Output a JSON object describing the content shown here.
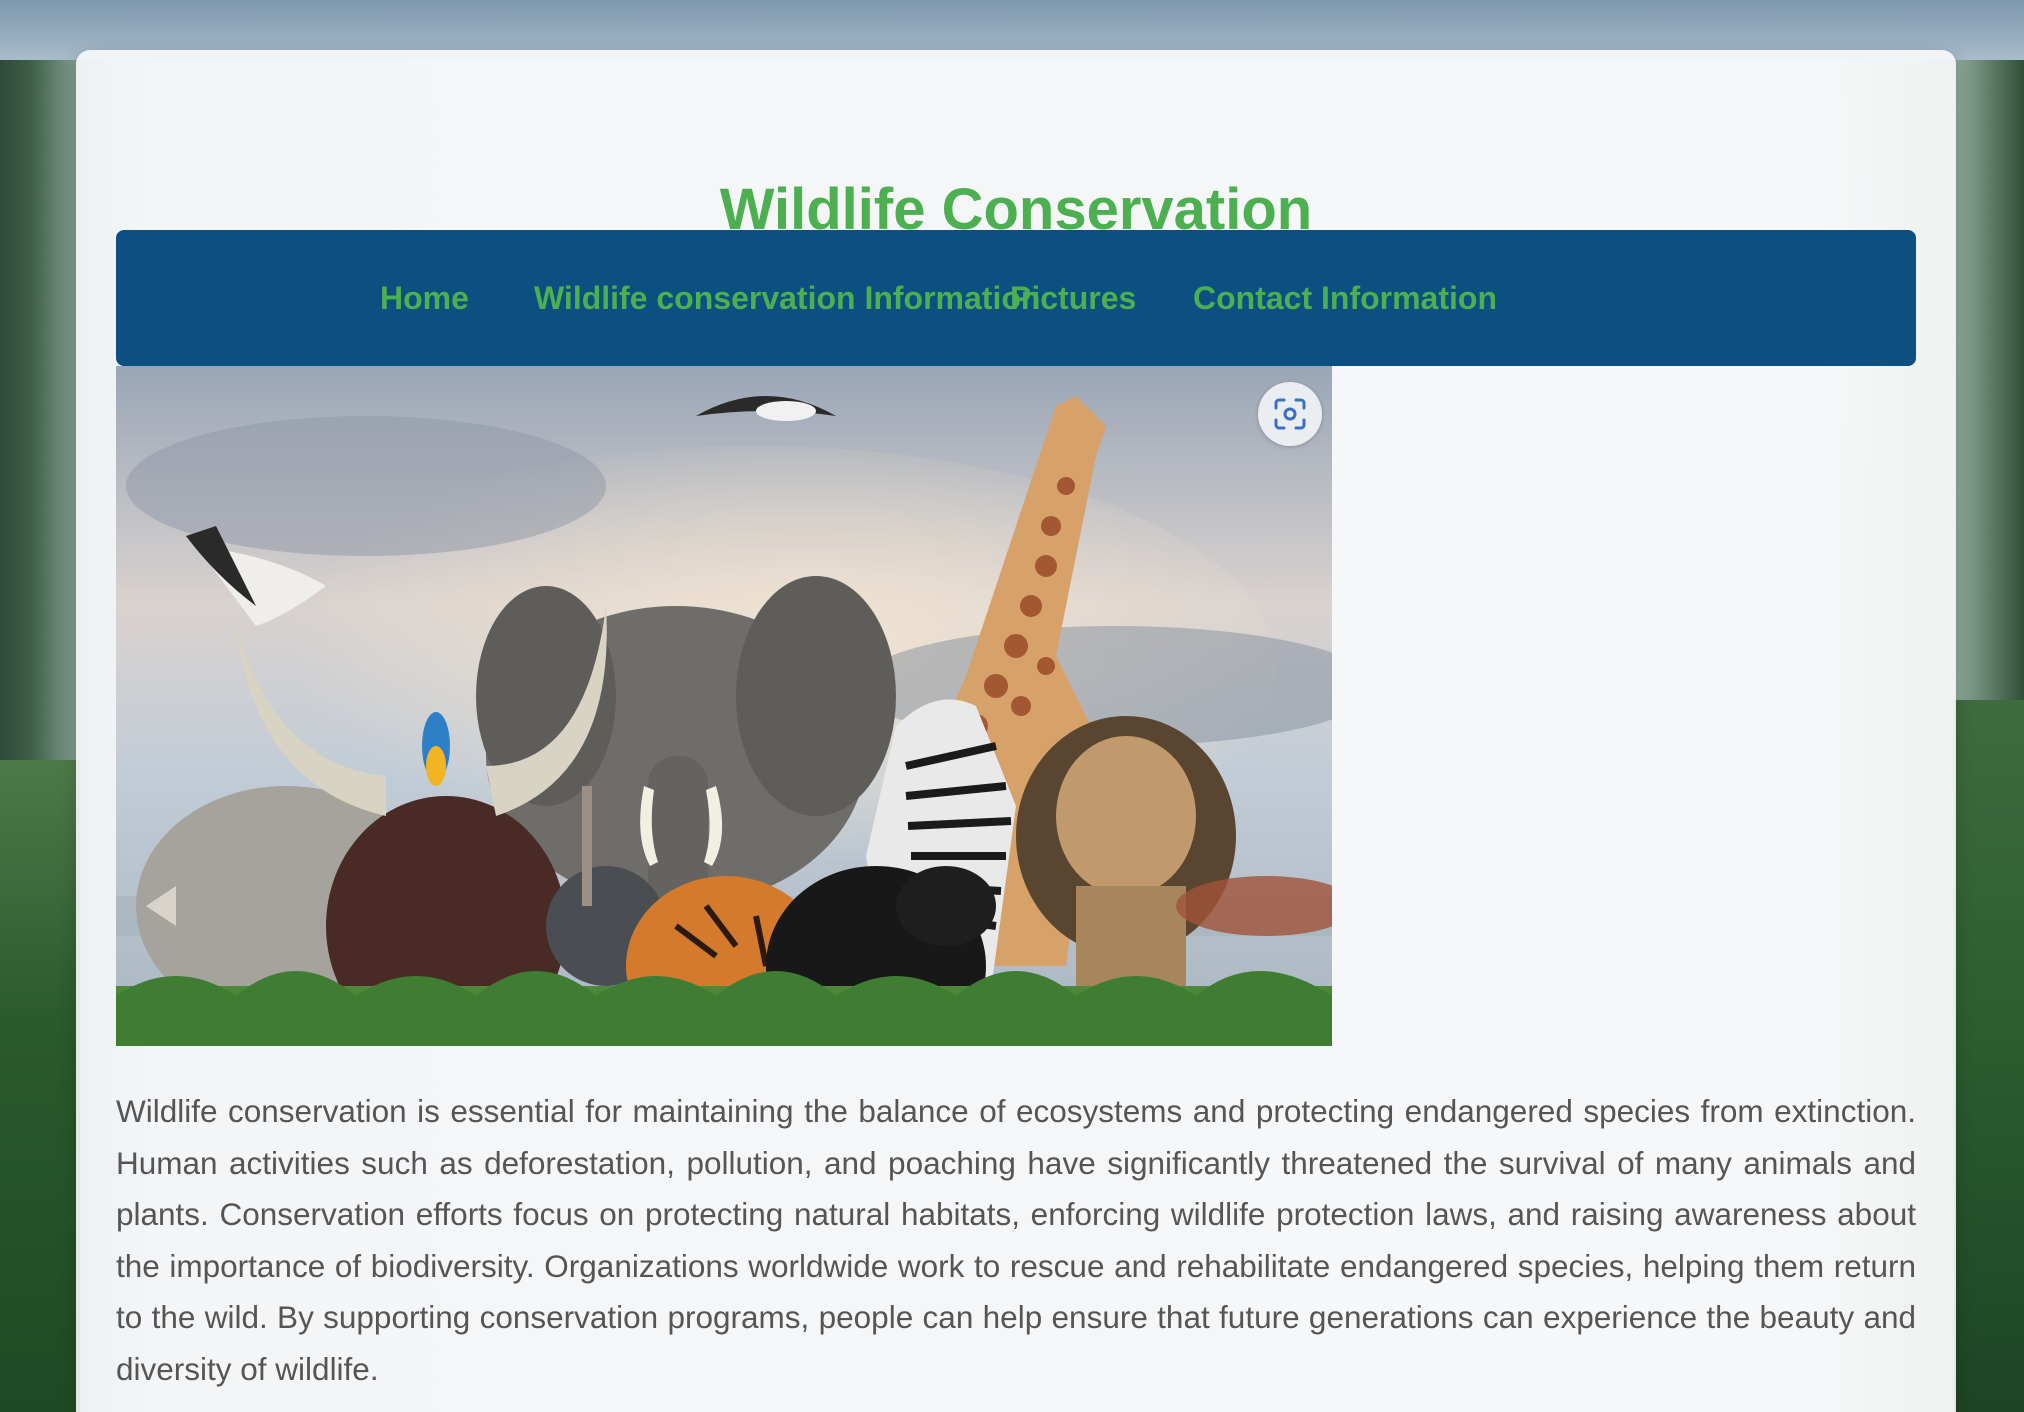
{
  "page": {
    "title": "Wildlife Conservation"
  },
  "nav": {
    "items": [
      {
        "label": "Home"
      },
      {
        "label": "Wildlife conservation Information"
      },
      {
        "label": "Pictures"
      },
      {
        "label": "Contact Information"
      }
    ]
  },
  "hero": {
    "icon": "visual-search-icon"
  },
  "content": {
    "paragraph": "Wildlife conservation is essential for maintaining the balance of ecosystems and protecting endangered species from extinction. Human activities such as deforestation, pollution, and poaching have significantly threatened the survival of many animals and plants. Conservation efforts focus on protecting natural habitats, enforcing wildlife protection laws, and raising awareness about the importance of biodiversity. Organizations worldwide work to rescue and rehabilitate endangered species, helping them return to the wild. By supporting conservation programs, people can help ensure that future generations can experience the beauty and diversity of wildlife."
  },
  "colors": {
    "accent": "#4caf50",
    "nav_bg": "#0b5081",
    "text": "#555555"
  }
}
